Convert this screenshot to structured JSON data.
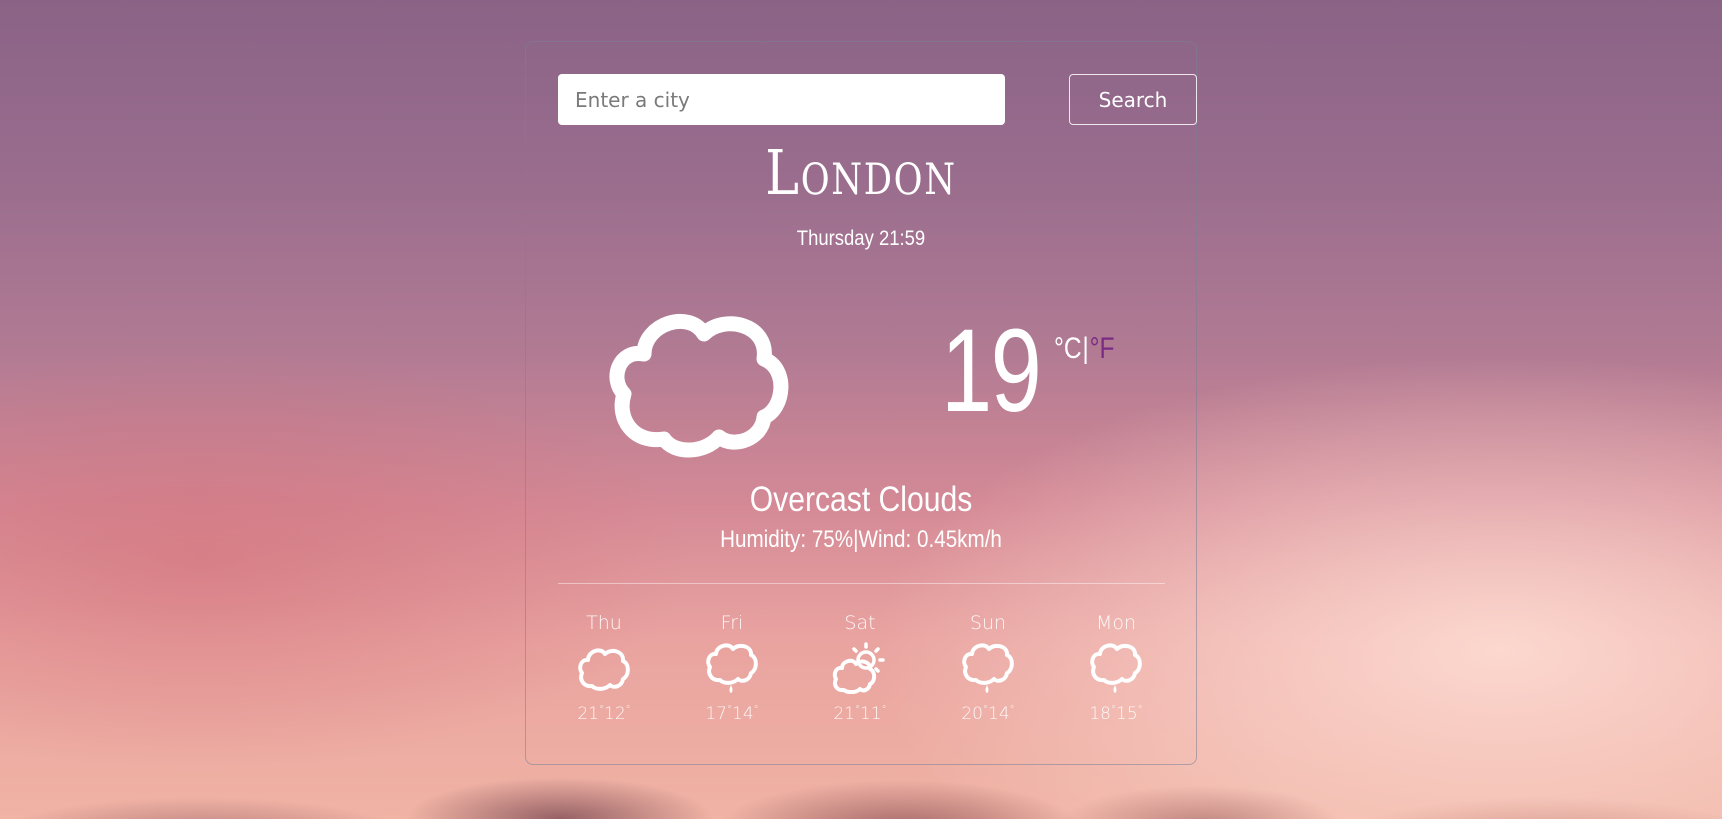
{
  "search": {
    "placeholder": "Enter a city",
    "value": "",
    "button_label": "Search"
  },
  "current": {
    "city": "London",
    "datetime": "Thursday 21:59",
    "icon": "cloud-icon",
    "temperature": "19",
    "unit_celsius": "°C",
    "unit_separator": "|",
    "unit_fahrenheit": "°F",
    "description": "Overcast Clouds",
    "humidity_label": "Humidity: 75%",
    "details_separator": "|",
    "wind_label": "Wind: 0.45km/h"
  },
  "forecast": [
    {
      "day": "Thu",
      "icon": "cloud-icon",
      "max": "21",
      "min": "12"
    },
    {
      "day": "Fri",
      "icon": "cloud-rain-icon",
      "max": "17",
      "min": "14"
    },
    {
      "day": "Sat",
      "icon": "sun-cloud-icon",
      "max": "21",
      "min": "11"
    },
    {
      "day": "Sun",
      "icon": "cloud-rain-icon",
      "max": "20",
      "min": "14"
    },
    {
      "day": "Mon",
      "icon": "cloud-rain-icon",
      "max": "18",
      "min": "15"
    }
  ],
  "colors": {
    "accent_fahrenheit": "#7b2a84",
    "text": "#ffffff"
  }
}
